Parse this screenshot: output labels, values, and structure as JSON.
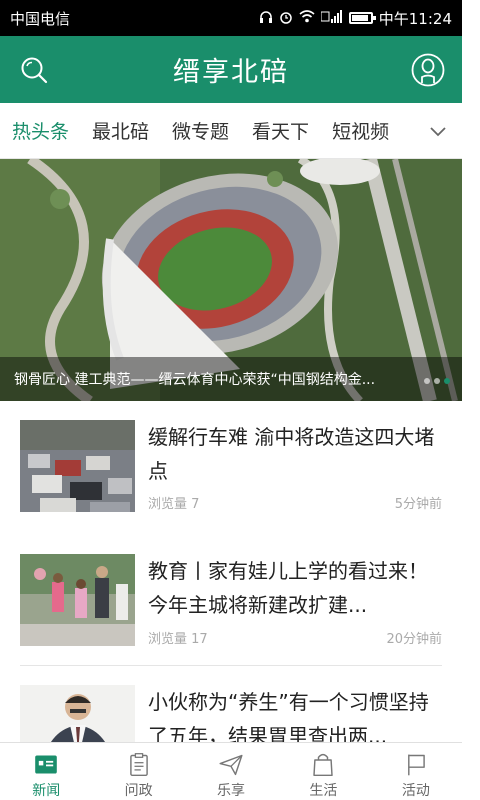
{
  "status_bar": {
    "carrier": "中国电信",
    "time": "中午11:24"
  },
  "header": {
    "title": "缙享北碚",
    "left_icon": "search-icon",
    "right_icon": "user-icon"
  },
  "tabs": {
    "items": [
      {
        "label": "热头条",
        "active": true
      },
      {
        "label": "最北碚"
      },
      {
        "label": "微专题"
      },
      {
        "label": "看天下"
      },
      {
        "label": "短视频"
      }
    ],
    "more_icon": "chevron-down-icon"
  },
  "banner": {
    "caption": "钢骨匠心 建工典范——缙云体育中心荣获“中国钢结构金...",
    "dots": 3,
    "active_dot": 2
  },
  "news": [
    {
      "title": "缓解行车难 渝中将改造这四大堵点",
      "views": "浏览量 7",
      "time": "5分钟前"
    },
    {
      "title": "教育丨家有娃儿上学的看过来！今年主城将新建改扩建...",
      "views": "浏览量 17",
      "time": "20分钟前"
    },
    {
      "title": "小伙称为“养生”有一个习惯坚持了五年，结果胃里查出两..."
    }
  ],
  "bottom_nav": {
    "items": [
      {
        "label": "新闻",
        "icon": "news-icon",
        "active": true
      },
      {
        "label": "问政",
        "icon": "clipboard-icon"
      },
      {
        "label": "乐享",
        "icon": "paper-plane-icon"
      },
      {
        "label": "生活",
        "icon": "shopping-bag-icon"
      },
      {
        "label": "活动",
        "icon": "flag-icon"
      }
    ]
  },
  "colors": {
    "brand_green": "#1a8e6b",
    "status_bar": "#000000"
  }
}
